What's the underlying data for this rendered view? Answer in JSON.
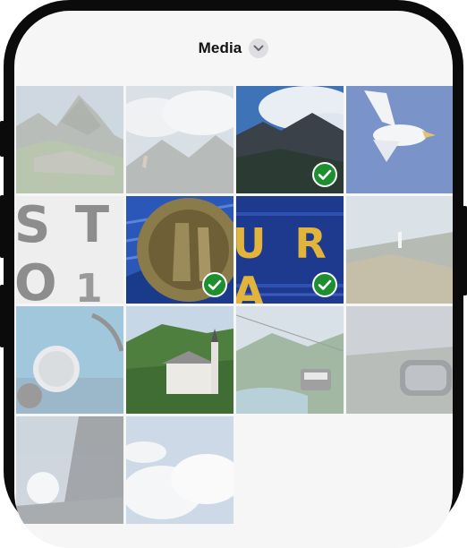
{
  "header": {
    "title": "Media",
    "dropdown_icon": "chevron-down-icon"
  },
  "tiles": [
    {
      "name": "photo-machu-picchu",
      "selected": false
    },
    {
      "name": "photo-mountain-clouds",
      "selected": false
    },
    {
      "name": "photo-mountain-blue-sky",
      "selected": true
    },
    {
      "name": "photo-seagull",
      "selected": false
    },
    {
      "name": "photo-letters-sto",
      "selected": false,
      "text": "S T O",
      "subtext": "1"
    },
    {
      "name": "photo-metal-emblem",
      "selected": true
    },
    {
      "name": "photo-blue-letters-ura",
      "selected": true,
      "text": "U R A"
    },
    {
      "name": "photo-hillside-statue",
      "selected": false
    },
    {
      "name": "photo-car-dashboard",
      "selected": false
    },
    {
      "name": "photo-white-church",
      "selected": false
    },
    {
      "name": "photo-cable-car-bay",
      "selected": false
    },
    {
      "name": "photo-road-side-mirror",
      "selected": false
    },
    {
      "name": "photo-sun-cliff",
      "selected": false
    },
    {
      "name": "photo-white-clouds",
      "selected": false
    }
  ],
  "colors": {
    "check": "#1e8f2e",
    "screen_bg": "#f6f6f7"
  }
}
